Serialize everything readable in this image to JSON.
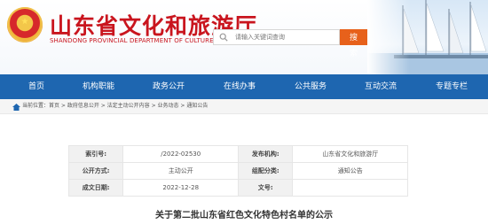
{
  "header": {
    "title": "山东省文化和旅游厅",
    "subtitle": "SHANDONG PROVINCIAL DEPARTMENT OF CULTURE AND TOURISM",
    "search": {
      "placeholder": "请输入关键词查询",
      "button_label": "搜 索"
    }
  },
  "nav": {
    "items": [
      {
        "label": "首页"
      },
      {
        "label": "机构职能"
      },
      {
        "label": "政务公开"
      },
      {
        "label": "在线办事"
      },
      {
        "label": "公共服务"
      },
      {
        "label": "互动交流"
      },
      {
        "label": "专题专栏"
      }
    ]
  },
  "breadcrumb": {
    "text": "当前位置：首页 > 政府信息公开 > 法定主动公开内容 > 业务动态 > 通知公告"
  },
  "meta": {
    "index_label": "索引号:",
    "index_value": "/2022-02530",
    "publisher_label": "发布机构:",
    "publisher_value": "山东省文化和旅游厅",
    "mode_label": "公开方式:",
    "mode_value": "主动公开",
    "category_label": "组配分类:",
    "category_value": "通知公告",
    "date_label": "成文日期:",
    "date_value": "2022-12-28",
    "doc_label": "文号:",
    "doc_value": ""
  },
  "article": {
    "title": "关于第二批山东省红色文化特色村名单的公示"
  },
  "colors": {
    "brand_red": "#c9151e",
    "nav_blue": "#1e66b0",
    "search_orange": "#e7611b"
  }
}
